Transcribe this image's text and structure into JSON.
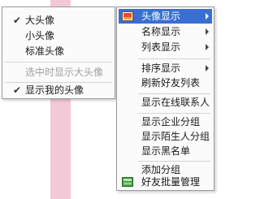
{
  "submenu": {
    "items": [
      {
        "label": "大头像",
        "checked": true
      },
      {
        "label": "小头像",
        "checked": false
      },
      {
        "label": "标准头像",
        "checked": false
      },
      {
        "label": "选中时显示大头像",
        "disabled": true
      },
      {
        "label": "显示我的头像",
        "checked": true
      }
    ]
  },
  "mainmenu": {
    "items": [
      {
        "label": "头像显示",
        "has_submenu": true,
        "highlighted": true,
        "icon": "avatar-picture-icon"
      },
      {
        "label": "名称显示",
        "has_submenu": true
      },
      {
        "label": "列表显示",
        "has_submenu": true
      },
      {
        "label": "排序显示",
        "has_submenu": true
      },
      {
        "label": "刷新好友列表"
      },
      {
        "label": "显示在线联系人"
      },
      {
        "label": "显示企业分组"
      },
      {
        "label": "显示陌生人分组"
      },
      {
        "label": "显示黑名单"
      },
      {
        "label": "添加分组"
      },
      {
        "label": "好友批量管理",
        "icon": "batch-manage-icon"
      }
    ]
  },
  "colors": {
    "highlight": "#3a6fd1",
    "background_stripe": "#f4c9d7",
    "menu_background": "#fbfbfb"
  }
}
